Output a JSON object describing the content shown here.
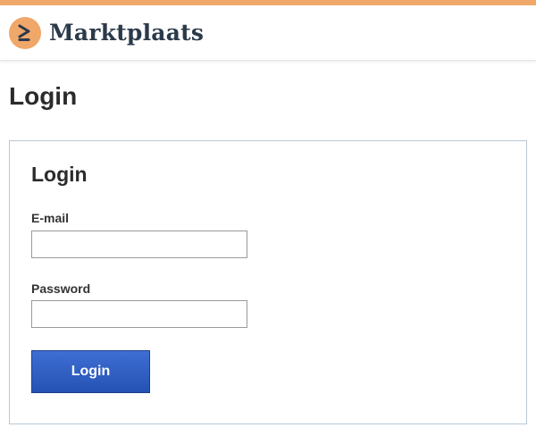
{
  "header": {
    "logo_icon": "chevron-right-arrow-icon",
    "brand_name": "Marktplaats",
    "accent_color": "#f0a76a"
  },
  "page": {
    "title": "Login"
  },
  "login_form": {
    "title": "Login",
    "email": {
      "label": "E-mail",
      "value": "",
      "placeholder": ""
    },
    "password": {
      "label": "Password",
      "value": "",
      "placeholder": ""
    },
    "submit_label": "Login",
    "button_color": "#2f5fc4",
    "border_color": "#b9c8d6"
  }
}
